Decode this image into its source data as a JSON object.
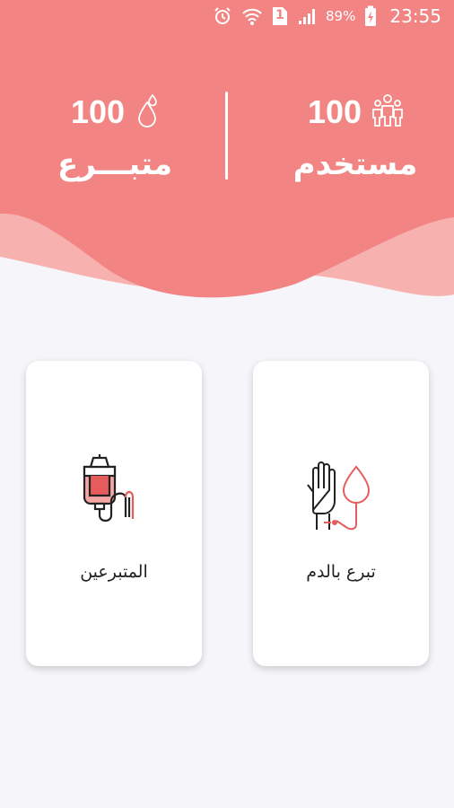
{
  "status_bar": {
    "battery_percent": "89%",
    "time": "23:55",
    "sim_slot": "1",
    "icons": [
      "alarm-icon",
      "wifi-icon",
      "sim-icon",
      "signal-icon",
      "battery-charging-icon"
    ]
  },
  "stats": {
    "users": {
      "count": "100",
      "label": "مستخدم",
      "icon": "users-group-icon"
    },
    "donors": {
      "count": "100",
      "label": "متبـــرع",
      "icon": "blood-drop-icon"
    }
  },
  "cards": {
    "donate": {
      "label": "تبرع بالدم",
      "icon": "hand-blood-donation-icon"
    },
    "donors": {
      "label": "المتبرعين",
      "icon": "iv-blood-bag-icon"
    }
  },
  "colors": {
    "brand": "#f28583",
    "brand_light": "#f7b2b0",
    "background": "#f6f6fa"
  }
}
